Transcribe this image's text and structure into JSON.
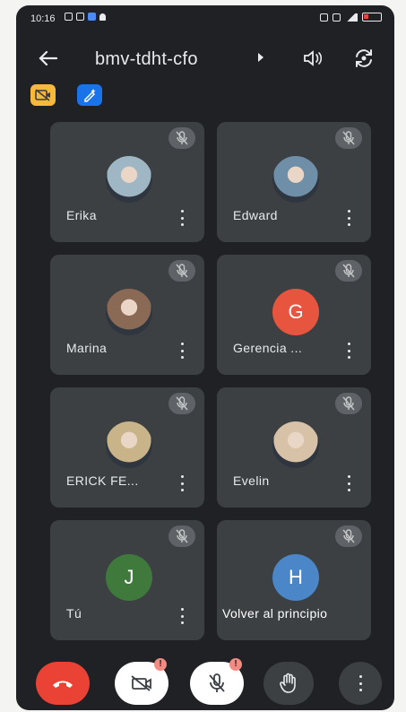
{
  "status_bar": {
    "time": "10:16"
  },
  "header": {
    "title": "bmv-tdht-cfo"
  },
  "participants": [
    {
      "name": "Erika",
      "avatar_type": "photo",
      "avatar_color": "#9fb7c4",
      "muted": true
    },
    {
      "name": "Edward",
      "avatar_type": "photo",
      "avatar_color": "#6f8fa8",
      "muted": true
    },
    {
      "name": "Marina",
      "avatar_type": "photo",
      "avatar_color": "#8a6a55",
      "muted": true
    },
    {
      "name": "Gerencia ...",
      "avatar_type": "initial",
      "initial": "G",
      "avatar_color": "#e8553e",
      "muted": true
    },
    {
      "name": "ERICK FE...",
      "avatar_type": "photo",
      "avatar_color": "#c9b48a",
      "muted": true
    },
    {
      "name": "Evelin",
      "avatar_type": "photo",
      "avatar_color": "#d7c2a8",
      "muted": true
    },
    {
      "name": "Tú",
      "avatar_type": "initial",
      "initial": "J",
      "avatar_color": "#3f7a3c",
      "muted": true
    },
    {
      "name": "Volver al principio",
      "avatar_type": "initial",
      "initial": "H",
      "avatar_color": "#4a86c8",
      "muted": true
    }
  ],
  "controls": {
    "camera_alert": "!",
    "mic_alert": "!"
  },
  "colors": {
    "background": "#202124",
    "tile": "#3c4043",
    "hangup": "#ea4335",
    "accent_blue": "#1a73e8"
  }
}
